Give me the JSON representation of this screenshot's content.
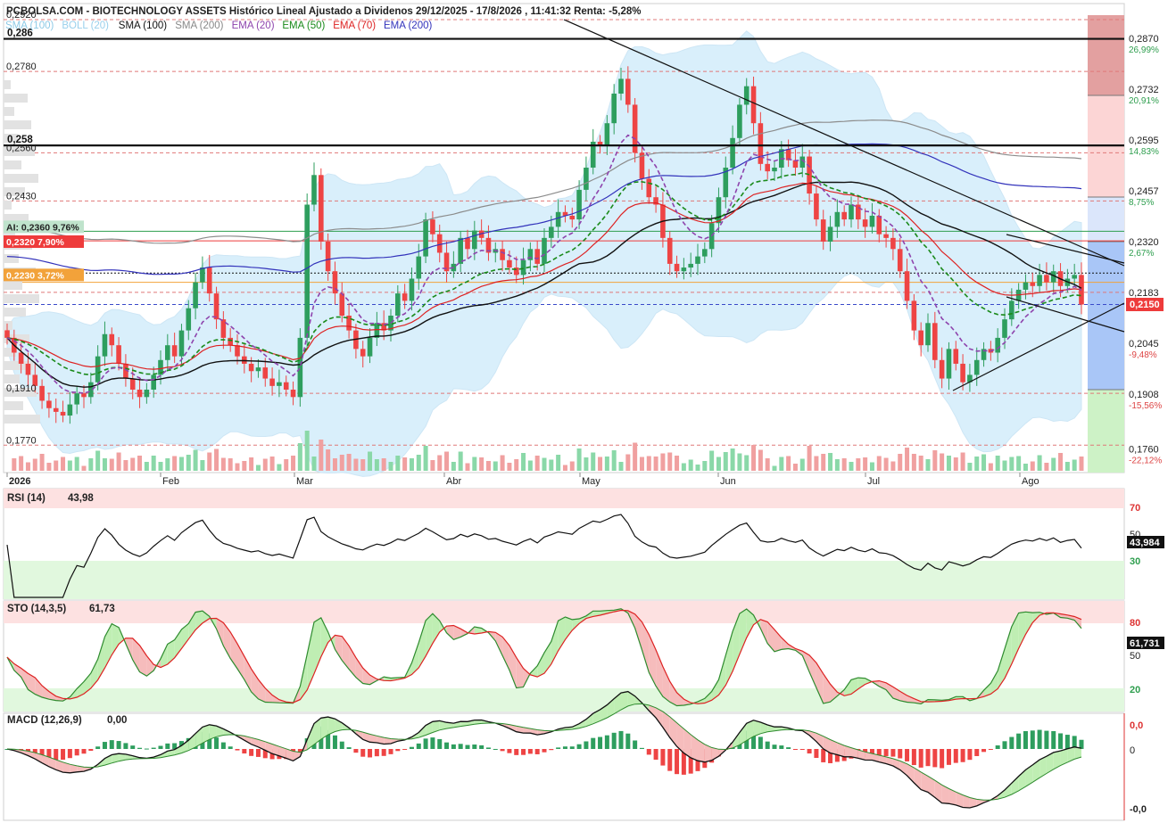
{
  "header": {
    "title": "PCBOLSA.COM - BIOTECHNOLOGY ASSETS Histórico Lineal Ajustado a Dividenos 29/12/2025 - 17/8/2026 , 11:41:32 Renta: -5,28%",
    "legend": [
      {
        "text": "SMA (100)",
        "color": "#8ecae6"
      },
      {
        "text": "BOLL (20)",
        "color": "#9ad0ec"
      },
      {
        "text": "SMA (100)",
        "color": "#111111"
      },
      {
        "text": "SMA (200)",
        "color": "#888888"
      },
      {
        "text": "EMA (20)",
        "color": "#8e44ad"
      },
      {
        "text": "EMA (50)",
        "color": "#1a8a1a"
      },
      {
        "text": "EMA (70)",
        "color": "#dd2222"
      },
      {
        "text": "EMA (200)",
        "color": "#3333bb"
      }
    ]
  },
  "price_axis": {
    "left_labels": [
      "0,2920",
      "0,2780",
      "0,2560",
      "0,2430",
      "0,1910",
      "0,1770"
    ],
    "right_labels": [
      "0,2870",
      "0,2732",
      "0,2595",
      "0,2457",
      "0,2320",
      "0,2183",
      "0,2045",
      "0,1908",
      "0,1760"
    ],
    "pct_labels": [
      {
        "text": "26,99%",
        "color": "#2e9e4e"
      },
      {
        "text": "20,91%",
        "color": "#2e9e4e"
      },
      {
        "text": "14,83%",
        "color": "#2e9e4e"
      },
      {
        "text": "8,75%",
        "color": "#2e9e4e"
      },
      {
        "text": "2,67%",
        "color": "#2e9e4e"
      },
      {
        "text": "-3,40%",
        "color": "#dd4444"
      },
      {
        "text": "-9,48%",
        "color": "#dd4444"
      },
      {
        "text": "-15,56%",
        "color": "#dd4444"
      },
      {
        "text": "-22,12%",
        "color": "#dd4444"
      }
    ],
    "current_price": "0,2150"
  },
  "levels": [
    {
      "label": "0,286",
      "value": 0.2868
    },
    {
      "label": "0,258",
      "value": 0.258
    }
  ],
  "price_tags": [
    {
      "text": "AI: 0,2360  9,76%",
      "value": 0.236,
      "bg": "#bfe3cc",
      "fg": "#222222"
    },
    {
      "text": "0,2320  7,90%",
      "value": 0.232,
      "bg": "#ee3b3b",
      "fg": "#ffffff"
    },
    {
      "text": "0,2230  3,72%",
      "value": 0.223,
      "bg": "#f2a23a",
      "fg": "#ffffff"
    }
  ],
  "months": [
    "2026",
    "Feb",
    "Mar",
    "Abr",
    "May",
    "Jun",
    "Jul",
    "Ago"
  ],
  "rsi": {
    "title": "RSI (14)",
    "value": "43,98",
    "levels": [
      "70",
      "50",
      "30"
    ],
    "tag": "43,984"
  },
  "sto": {
    "title": "STO (14,3,5)",
    "value": "61,73",
    "levels": [
      "80",
      "50",
      "20"
    ],
    "tag": "61,731"
  },
  "macd": {
    "title": "MACD (12,26,9)",
    "value": "0,00",
    "levels": [
      "0,0",
      "0",
      "-0,0"
    ]
  },
  "chart_data": {
    "type": "candlestick",
    "ylim": [
      0.172,
      0.292
    ],
    "x_months": [
      "2026",
      "Feb",
      "Mar",
      "Abr",
      "May",
      "Jun",
      "Jul",
      "Ago"
    ],
    "closes": [
      0.206,
      0.202,
      0.199,
      0.196,
      0.193,
      0.189,
      0.187,
      0.186,
      0.185,
      0.188,
      0.191,
      0.19,
      0.194,
      0.201,
      0.207,
      0.204,
      0.199,
      0.195,
      0.192,
      0.19,
      0.192,
      0.196,
      0.2,
      0.204,
      0.201,
      0.208,
      0.214,
      0.221,
      0.225,
      0.218,
      0.211,
      0.206,
      0.204,
      0.201,
      0.199,
      0.197,
      0.198,
      0.195,
      0.193,
      0.194,
      0.192,
      0.19,
      0.206,
      0.242,
      0.25,
      0.232,
      0.224,
      0.218,
      0.212,
      0.208,
      0.203,
      0.201,
      0.206,
      0.21,
      0.208,
      0.212,
      0.218,
      0.216,
      0.222,
      0.228,
      0.238,
      0.234,
      0.229,
      0.224,
      0.226,
      0.233,
      0.23,
      0.235,
      0.233,
      0.229,
      0.23,
      0.227,
      0.225,
      0.223,
      0.227,
      0.23,
      0.226,
      0.233,
      0.236,
      0.24,
      0.239,
      0.238,
      0.246,
      0.252,
      0.259,
      0.258,
      0.264,
      0.272,
      0.276,
      0.269,
      0.256,
      0.249,
      0.244,
      0.242,
      0.233,
      0.226,
      0.224,
      0.225,
      0.226,
      0.228,
      0.23,
      0.237,
      0.244,
      0.252,
      0.26,
      0.269,
      0.274,
      0.264,
      0.253,
      0.251,
      0.252,
      0.257,
      0.254,
      0.252,
      0.255,
      0.245,
      0.238,
      0.232,
      0.236,
      0.24,
      0.238,
      0.242,
      0.238,
      0.236,
      0.239,
      0.234,
      0.233,
      0.23,
      0.224,
      0.216,
      0.208,
      0.204,
      0.21,
      0.2,
      0.195,
      0.203,
      0.199,
      0.194,
      0.196,
      0.2,
      0.203,
      0.202,
      0.206,
      0.211,
      0.216,
      0.219,
      0.221,
      0.22,
      0.223,
      0.221,
      0.224,
      0.22,
      0.222,
      0.223,
      0.215
    ]
  }
}
